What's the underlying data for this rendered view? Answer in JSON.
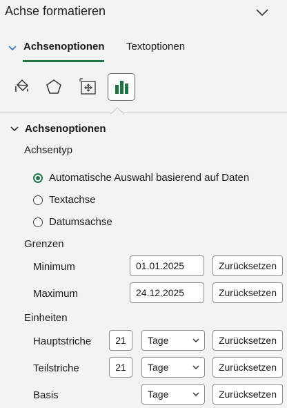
{
  "pane": {
    "title": "Achse formatieren"
  },
  "tabs": {
    "axis_options": "Achsenoptionen",
    "text_options": "Textoptionen"
  },
  "section": {
    "title": "Achsenoptionen"
  },
  "axis_type": {
    "label": "Achsentyp",
    "options": [
      {
        "label": "Automatische Auswahl basierend auf Daten",
        "checked": true
      },
      {
        "label": "Textachse",
        "checked": false
      },
      {
        "label": "Datumsachse",
        "checked": false
      }
    ]
  },
  "bounds": {
    "label": "Grenzen",
    "minimum": {
      "label": "Minimum",
      "value": "01.01.2025",
      "reset": "Zurücksetzen"
    },
    "maximum": {
      "label": "Maximum",
      "value": "24.12.2025",
      "reset": "Zurücksetzen"
    }
  },
  "units": {
    "label": "Einheiten",
    "major": {
      "label": "Hauptstriche",
      "value": "21",
      "unit": "Tage",
      "reset": "Zurücksetzen"
    },
    "minor": {
      "label": "Teilstriche",
      "value": "21",
      "unit": "Tage",
      "reset": "Zurücksetzen"
    },
    "base": {
      "label": "Basis",
      "unit": "Tage",
      "reset": "Zurücksetzen"
    }
  },
  "colors": {
    "accent": "#217346"
  }
}
